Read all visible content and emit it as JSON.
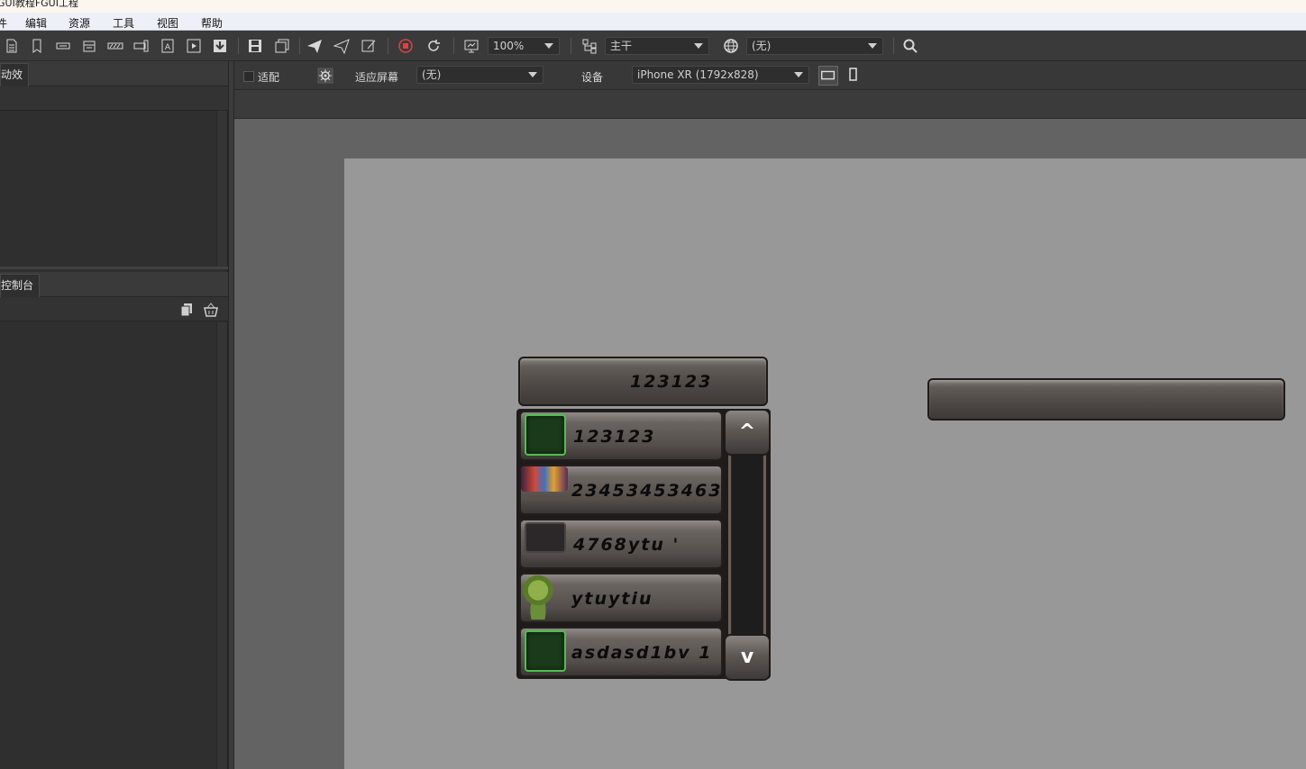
{
  "window": {
    "title": "GUI教程FGUI工程"
  },
  "menu": [
    "件",
    "编辑",
    "资源",
    "工具",
    "视图",
    "帮助"
  ],
  "toolbar": {
    "zoom": "100%",
    "branch": "主干",
    "language": "(无)"
  },
  "left_panel": {
    "top_tab": "动效",
    "bottom_tab": "控制台"
  },
  "canvas_bar": {
    "fit_label": "适配",
    "fit_screen_label": "适应屏幕",
    "fit_screen_value": "(无)",
    "device_label": "设备",
    "device_value": "iPhone XR (1792x828)"
  },
  "combobox": {
    "title": "123123",
    "items": [
      {
        "text": "123123"
      },
      {
        "text": "23453453463"
      },
      {
        "text": "4768ytu  '"
      },
      {
        "text": "ytuytiu"
      },
      {
        "text": "asdasd1bv 1"
      }
    ],
    "scroll_up": "^",
    "scroll_down": "v"
  },
  "colors": {
    "stage": "#989898",
    "workarea": "#636363",
    "accent_record": "#e04040"
  }
}
